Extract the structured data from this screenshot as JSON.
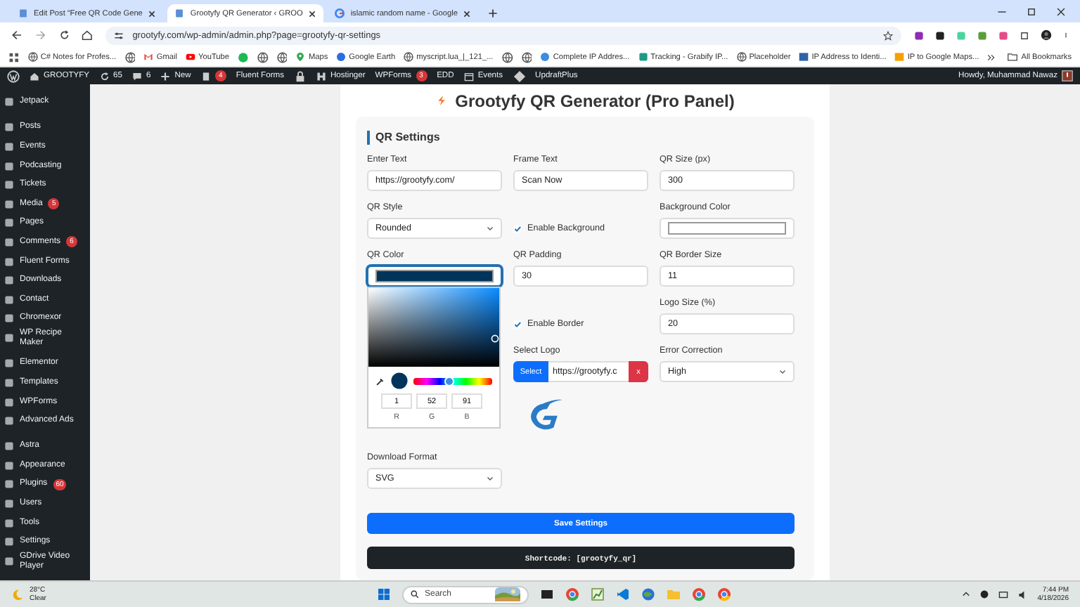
{
  "browser": {
    "tabs": [
      {
        "title": "Edit Post “Free QR Code Gene",
        "selected": false
      },
      {
        "title": "Grootyfy QR Generator ‹ GROO",
        "selected": true
      },
      {
        "title": "islamic random name - Google",
        "selected": false
      }
    ],
    "address": "grootyfy.com/wp-admin/admin.php?page=grootyfy-qr-settings",
    "bookmarks": [
      {
        "kind": "icon"
      },
      {
        "kind": "link",
        "label": "C# Notes for Profes..."
      },
      {
        "kind": "icon"
      },
      {
        "kind": "link",
        "label": "Gmail"
      },
      {
        "kind": "link",
        "label": "YouTube"
      },
      {
        "kind": "icon"
      },
      {
        "kind": "icon"
      },
      {
        "kind": "icon"
      },
      {
        "kind": "link",
        "label": "Maps"
      },
      {
        "kind": "link",
        "label": "Google Earth"
      },
      {
        "kind": "link",
        "label": "myscript.lua_|_121_..."
      },
      {
        "kind": "icon"
      },
      {
        "kind": "icon"
      },
      {
        "kind": "link",
        "label": "Complete IP Addres..."
      },
      {
        "kind": "link",
        "label": "Tracking - Grabify IP..."
      },
      {
        "kind": "link",
        "label": "Placeholder"
      },
      {
        "kind": "link",
        "label": "IP Address to Identi..."
      },
      {
        "kind": "link",
        "label": "IP to Google Maps..."
      }
    ],
    "all_bookmarks": "All Bookmarks"
  },
  "admin_bar": {
    "items": [
      {
        "kind": "icon"
      },
      {
        "kind": "item",
        "label": "GROOTYFY"
      },
      {
        "kind": "item",
        "label": "65"
      },
      {
        "kind": "item",
        "label": "6"
      },
      {
        "kind": "item",
        "label": "New"
      },
      {
        "kind": "item",
        "badge": "4"
      },
      {
        "kind": "item",
        "label": "Fluent Forms"
      },
      {
        "kind": "icon"
      },
      {
        "kind": "item",
        "label": "Hostinger"
      },
      {
        "kind": "item",
        "label": "WPForms",
        "badge": "3"
      },
      {
        "kind": "item",
        "label": "EDD"
      },
      {
        "kind": "item",
        "label": "Events"
      },
      {
        "kind": "icon"
      },
      {
        "kind": "item",
        "label": "UpdraftPlus"
      }
    ],
    "greeting": "Howdy, Muhammad Nawaz"
  },
  "sidebar": {
    "groups": [
      {
        "items": [
          {
            "label": "Jetpack"
          }
        ]
      },
      {
        "items": [
          {
            "label": "Posts"
          },
          {
            "label": "Events"
          },
          {
            "label": "Podcasting"
          },
          {
            "label": "Tickets"
          },
          {
            "label": "Media",
            "badge": "5"
          },
          {
            "label": "Pages"
          },
          {
            "label": "Comments",
            "badge": "6"
          },
          {
            "label": "Fluent Forms"
          },
          {
            "label": "Downloads"
          },
          {
            "label": "Contact"
          },
          {
            "label": "Chromexor"
          },
          {
            "label": "WP Recipe Maker"
          }
        ]
      },
      {
        "items": [
          {
            "label": "Elementor"
          },
          {
            "label": "Templates"
          },
          {
            "label": "WPForms"
          },
          {
            "label": "Advanced Ads"
          }
        ]
      },
      {
        "items": [
          {
            "label": "Astra"
          },
          {
            "label": "Appearance"
          },
          {
            "label": "Plugins",
            "badge": "60"
          },
          {
            "label": "Users"
          },
          {
            "label": "Tools"
          },
          {
            "label": "Settings"
          },
          {
            "label": "GDrive Video Player"
          }
        ]
      }
    ]
  },
  "page": {
    "title": "Grootyfy QR Generator (Pro Panel)",
    "section": "QR Settings",
    "rows": [
      {
        "left": {
          "kind": "text",
          "label": "Enter Text",
          "value": "https://grootyfy.com/"
        },
        "middle": {
          "kind": "text",
          "label": "Frame Text",
          "value": "Scan Now"
        },
        "right": {
          "kind": "text",
          "label": "QR Size (px)",
          "value": "300"
        }
      },
      {
        "left": {
          "kind": "select",
          "label": "QR Style",
          "value": "Rounded"
        },
        "middle": {
          "kind": "checkbox",
          "label": "Enable Background",
          "checked": true
        },
        "right": {
          "kind": "color",
          "label": "Background Color",
          "color": "#ffffff",
          "focused": false
        }
      },
      {
        "left": {
          "kind": "color",
          "label": "QR Color",
          "color": "#01345b",
          "focused": true,
          "picker": {
            "hue": {
              "level": 0.45
            },
            "channels": [
              {
                "label": "R",
                "value": "1"
              },
              {
                "label": "G",
                "value": "52"
              },
              {
                "label": "B",
                "value": "91"
              }
            ]
          }
        },
        "middle": {
          "kind": "text",
          "label": "QR Padding",
          "value": "30"
        },
        "right": {
          "kind": "text",
          "label": "QR Border Size",
          "value": "11"
        }
      },
      {
        "middle": {
          "kind": "checkbox",
          "label": "Enable Border",
          "checked": true
        },
        "right": {
          "kind": "text",
          "label": "Logo Size (%)",
          "value": "20"
        }
      },
      {
        "middle": {
          "kind": "logo",
          "label": "Select Logo",
          "button": "Select",
          "value": "https://grootyfy.c",
          "remove": "x"
        },
        "right": {
          "kind": "select",
          "label": "Error Correction",
          "value": "High"
        }
      },
      {
        "middle": {
          "kind": "preview"
        }
      },
      {
        "left": {
          "kind": "select",
          "label": "Download Format",
          "value": "SVG"
        }
      }
    ],
    "save": "Save Settings",
    "shortcode": "Shortcode: [grootyfy_qr]"
  },
  "taskbar": {
    "weather": {
      "temp": "28°C",
      "condition": "Clear"
    },
    "search": {
      "placeholder": "Search"
    },
    "time": "7:44 PM",
    "date": "4/18/2026"
  }
}
